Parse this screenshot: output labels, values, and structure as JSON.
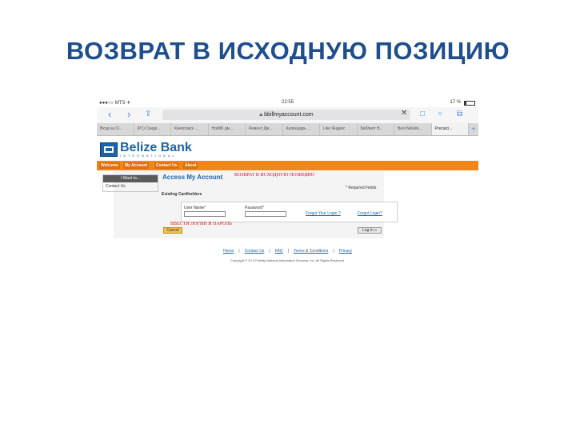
{
  "slide": {
    "title": "ВОЗВРАТ В ИСХОДНУЮ ПОЗИЦИЮ"
  },
  "status_bar": {
    "carrier": "●●●○○ MTS  ✈",
    "time": "22:55",
    "battery": "17 %"
  },
  "browser": {
    "url": "bbillmyaccount.com",
    "tabs": [
      "Вход на Cl...",
      "(Р1) Скидк...",
      "Кинопоиск ...",
      "HotФБ дм...",
      "Ремонт Дж...",
      "Календарь ...",
      "Like Яндекс",
      "Библиот В...",
      "Best Melafe...",
      "Precaici..."
    ],
    "accent": "#4a84d6"
  },
  "bank": {
    "logo_name": "Belize Bank",
    "logo_sub": "INTERNATIONAL",
    "nav": [
      "Welcome",
      "My Account",
      "Contact Us",
      "About"
    ],
    "side_title": "I Want to...",
    "side_item": "Contact Us",
    "access_title": "Access My Account",
    "required_note": "* Required Fields",
    "section_title": "Existing Cardholders",
    "username_label": "User Name*",
    "password_label": "Password*",
    "forgot_user": "Forgot Your Login ?",
    "forgot_pass": "Forgot Login?",
    "cancel_label": "Cancel",
    "login_label": "Log In  »",
    "footer_links": [
      "Home",
      "Contact Us",
      "FAQ",
      "Terms & Conditions",
      "Privacy"
    ],
    "copyright": "Copyright © 20 3 Fidelity National Information Services, Inc. All Rights Reserved.",
    "brand_color": "#1b64a6",
    "nav_color": "#f0871a"
  },
  "annotations": {
    "return_note": "ВОЗВРАТ В ИСХОДНУЮ ПОЗИЦИЮ",
    "enter_note": "ВВЕСТИ ЛОГИН И ПАРОЛЬ",
    "color": "#d01414"
  }
}
